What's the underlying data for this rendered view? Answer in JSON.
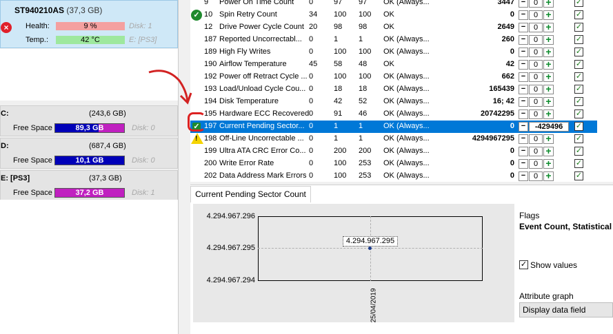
{
  "disk": {
    "name": "ST940210AS",
    "size": "(37,3 GB)",
    "health_label": "Health:",
    "health_value": "9 %",
    "health_disk": "Disk: 1",
    "temp_label": "Temp.:",
    "temp_value": "42 °C",
    "temp_disk": "E: [PS3]",
    "health_status_icon": "error-x-icon"
  },
  "volumes": [
    {
      "name": "C:",
      "size": "(243,6 GB)",
      "free_label": "Free Space",
      "free": "89,3 GB",
      "disk": "Disk: 0",
      "bar_color": "#0000b8",
      "bar_fill_color": "#c020c0",
      "used_fraction": 0.63
    },
    {
      "name": "D:",
      "size": "(687,4 GB)",
      "free_label": "Free Space",
      "free": "10,1 GB",
      "disk": "Disk: 0",
      "bar_color": "#0000b8",
      "bar_fill_color": "#0000b8",
      "used_fraction": 1.0
    },
    {
      "name": "E: [PS3]",
      "size": "(37,3 GB)",
      "free_label": "Free Space",
      "free": "37,2 GB",
      "disk": "Disk: 1",
      "bar_color": "#c020c0",
      "bar_fill_color": "#c020c0",
      "used_fraction": 1.0
    }
  ],
  "attributes": [
    {
      "id": "9",
      "name": "Power On Time Count",
      "raw": "0",
      "v1": "97",
      "v2": "97",
      "status": "OK (Always...",
      "count": "3447",
      "ctr": "0",
      "checked": true,
      "icon": ""
    },
    {
      "id": "10",
      "name": "Spin Retry Count",
      "raw": "34",
      "v1": "100",
      "v2": "100",
      "status": "OK",
      "count": "0",
      "ctr": "0",
      "checked": true,
      "icon": "ok"
    },
    {
      "id": "12",
      "name": "Drive Power Cycle Count",
      "raw": "20",
      "v1": "98",
      "v2": "98",
      "status": "OK",
      "count": "2649",
      "ctr": "0",
      "checked": true,
      "icon": ""
    },
    {
      "id": "187",
      "name": "Reported Uncorrectabl...",
      "raw": "0",
      "v1": "1",
      "v2": "1",
      "status": "OK (Always...",
      "count": "260",
      "ctr": "0",
      "checked": true,
      "icon": ""
    },
    {
      "id": "189",
      "name": "High Fly Writes",
      "raw": "0",
      "v1": "100",
      "v2": "100",
      "status": "OK (Always...",
      "count": "0",
      "ctr": "0",
      "checked": true,
      "icon": ""
    },
    {
      "id": "190",
      "name": "Airflow Temperature",
      "raw": "45",
      "v1": "58",
      "v2": "48",
      "status": "OK",
      "count": "42",
      "ctr": "0",
      "checked": true,
      "icon": ""
    },
    {
      "id": "192",
      "name": "Power off Retract Cycle ...",
      "raw": "0",
      "v1": "100",
      "v2": "100",
      "status": "OK (Always...",
      "count": "662",
      "ctr": "0",
      "checked": true,
      "icon": ""
    },
    {
      "id": "193",
      "name": "Load/Unload Cycle Cou...",
      "raw": "0",
      "v1": "18",
      "v2": "18",
      "status": "OK (Always...",
      "count": "165439",
      "ctr": "0",
      "checked": true,
      "icon": ""
    },
    {
      "id": "194",
      "name": "Disk Temperature",
      "raw": "0",
      "v1": "42",
      "v2": "52",
      "status": "OK (Always...",
      "count": "16; 42",
      "ctr": "0",
      "checked": true,
      "icon": ""
    },
    {
      "id": "195",
      "name": "Hardware ECC Recovered",
      "raw": "0",
      "v1": "91",
      "v2": "46",
      "status": "OK (Always...",
      "count": "20742295",
      "ctr": "0",
      "checked": true,
      "icon": ""
    },
    {
      "id": "197",
      "name": "Current Pending Sector...",
      "raw": "0",
      "v1": "1",
      "v2": "1",
      "status": "OK (Always...",
      "count": "0",
      "ctr": "-429496",
      "checked": true,
      "icon": "ok-small",
      "selected": true
    },
    {
      "id": "198",
      "name": "Off-Line Uncorrectable ...",
      "raw": "0",
      "v1": "1",
      "v2": "1",
      "status": "OK (Always...",
      "count": "4294967295",
      "ctr": "0",
      "checked": true,
      "icon": "warning"
    },
    {
      "id": "199",
      "name": "Ultra ATA CRC Error Co...",
      "raw": "0",
      "v1": "200",
      "v2": "200",
      "status": "OK (Always...",
      "count": "0",
      "ctr": "0",
      "checked": true,
      "icon": ""
    },
    {
      "id": "200",
      "name": "Write Error Rate",
      "raw": "0",
      "v1": "100",
      "v2": "253",
      "status": "OK (Always...",
      "count": "0",
      "ctr": "0",
      "checked": true,
      "icon": ""
    },
    {
      "id": "202",
      "name": "Data Address Mark Errors",
      "raw": "0",
      "v1": "100",
      "v2": "253",
      "status": "OK (Always...",
      "count": "0",
      "ctr": "0",
      "checked": true,
      "icon": ""
    }
  ],
  "minus": "−",
  "plus": "+",
  "check": "✓",
  "detail": {
    "tab": "Current Pending Sector Count",
    "flags_label": "Flags",
    "flags_value": "Event Count, Statistical",
    "show_values": "Show values",
    "show_values_checked": true,
    "graph_label": "Attribute graph",
    "graph_select": "Display data field"
  },
  "chart_data": {
    "type": "scatter",
    "x": [
      "25/04/2019"
    ],
    "series": [
      {
        "values": [
          4294967295
        ]
      }
    ],
    "ylim": [
      4294967294,
      4294967296
    ],
    "y_ticks": [
      "4.294.967.296",
      "4.294.967.295",
      "4.294.967.294"
    ],
    "x_ticks": [
      "25/04/2019"
    ],
    "data_labels": [
      "4.294.967.295"
    ],
    "grid": true
  },
  "colors": {
    "selected_row": "#0078d7",
    "ok_green": "#1f8a2e",
    "annotation_red": "#d22222"
  }
}
